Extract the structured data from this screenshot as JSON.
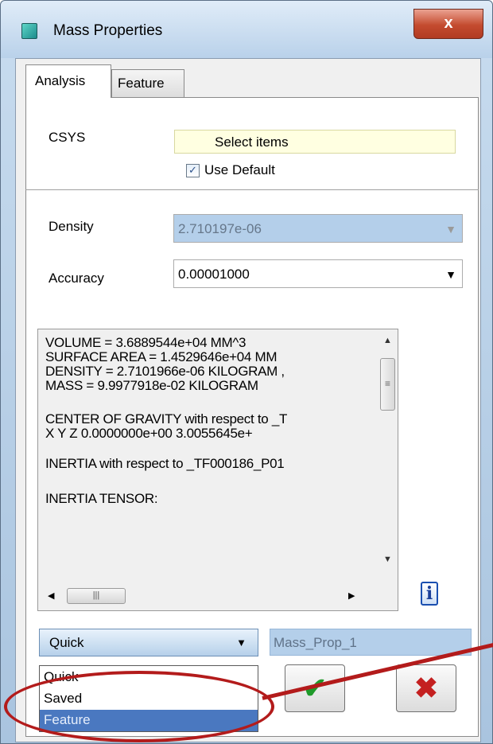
{
  "window": {
    "title": "Mass Properties",
    "close_label": "x"
  },
  "tabs": [
    {
      "label": "Analysis",
      "active": true
    },
    {
      "label": "Feature",
      "active": false
    }
  ],
  "csys": {
    "label": "CSYS",
    "collector_text": "Select items",
    "use_default_label": "Use Default",
    "use_default_checked": true
  },
  "density": {
    "label": "Density",
    "value": "2.710197e-06"
  },
  "accuracy": {
    "label": "Accuracy",
    "value": "0.00001000"
  },
  "results": {
    "lines": [
      "VOLUME =  3.6889544e+04  MM^3",
      "SURFACE AREA =  1.4529646e+04  MM",
      "DENSITY =  2.7101966e-06 KILOGRAM ,",
      "MASS =  9.9977918e-02 KILOGRAM",
      "",
      "CENTER OF GRAVITY with respect to _T",
      "X  Y  Z     0.0000000e+00  3.0055645e+",
      "",
      "INERTIA with respect to _TF000186_P01",
      "",
      "INERTIA TENSOR:"
    ]
  },
  "analysis_type": {
    "selected": "Quick",
    "options": [
      "Quick",
      "Saved",
      "Feature"
    ],
    "highlighted": "Feature"
  },
  "analysis_name": "Mass_Prop_1",
  "colors": {
    "accent_selection": "#4a78c0",
    "annotation_red": "#b31b1b",
    "ok_green": "#1f9a2a",
    "cancel_red": "#c42020"
  },
  "icons": {
    "info": "info-icon",
    "ok": "checkmark-icon",
    "cancel": "x-icon"
  }
}
